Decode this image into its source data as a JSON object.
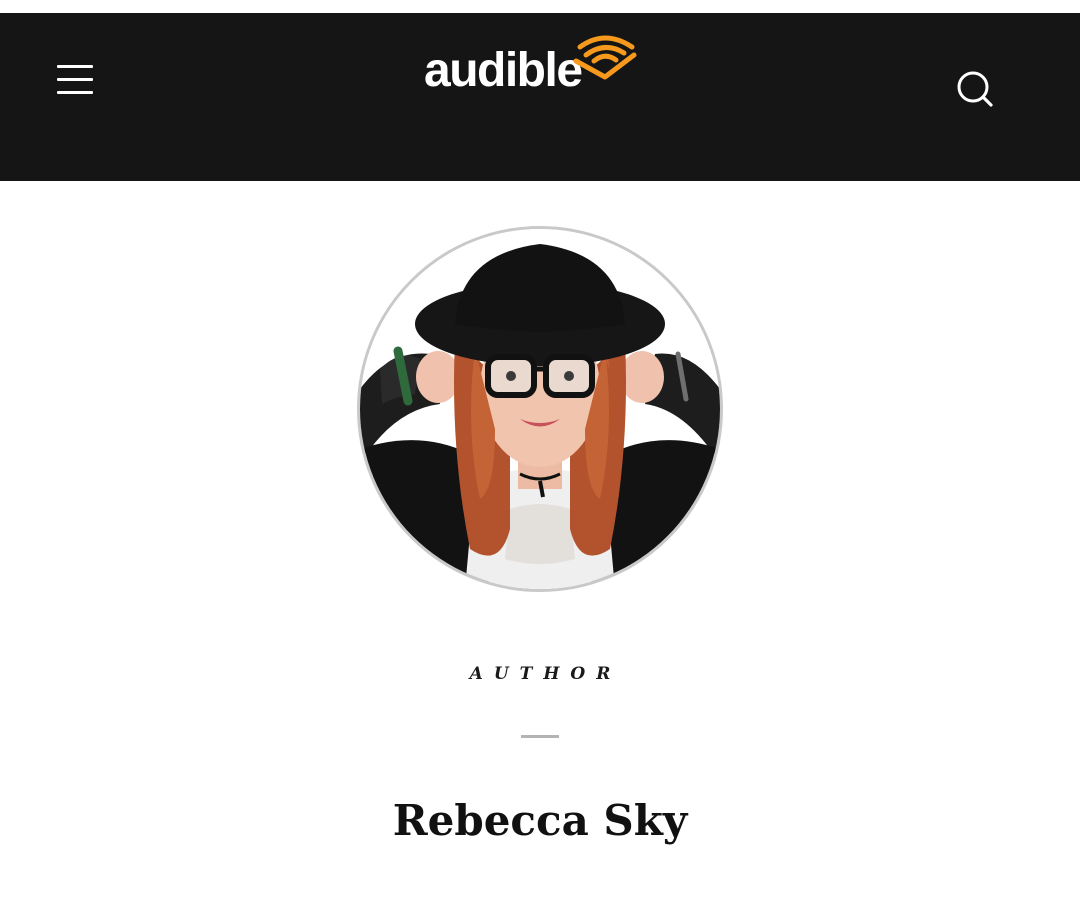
{
  "header": {
    "logo_text": "audible",
    "menu_icon": "hamburger-menu-icon",
    "search_icon": "search-icon",
    "brand_accent": "#F7991C",
    "background": "#151515"
  },
  "profile": {
    "avatar_alt": "",
    "role_label": "AUTHOR",
    "name": "Rebecca Sky"
  }
}
